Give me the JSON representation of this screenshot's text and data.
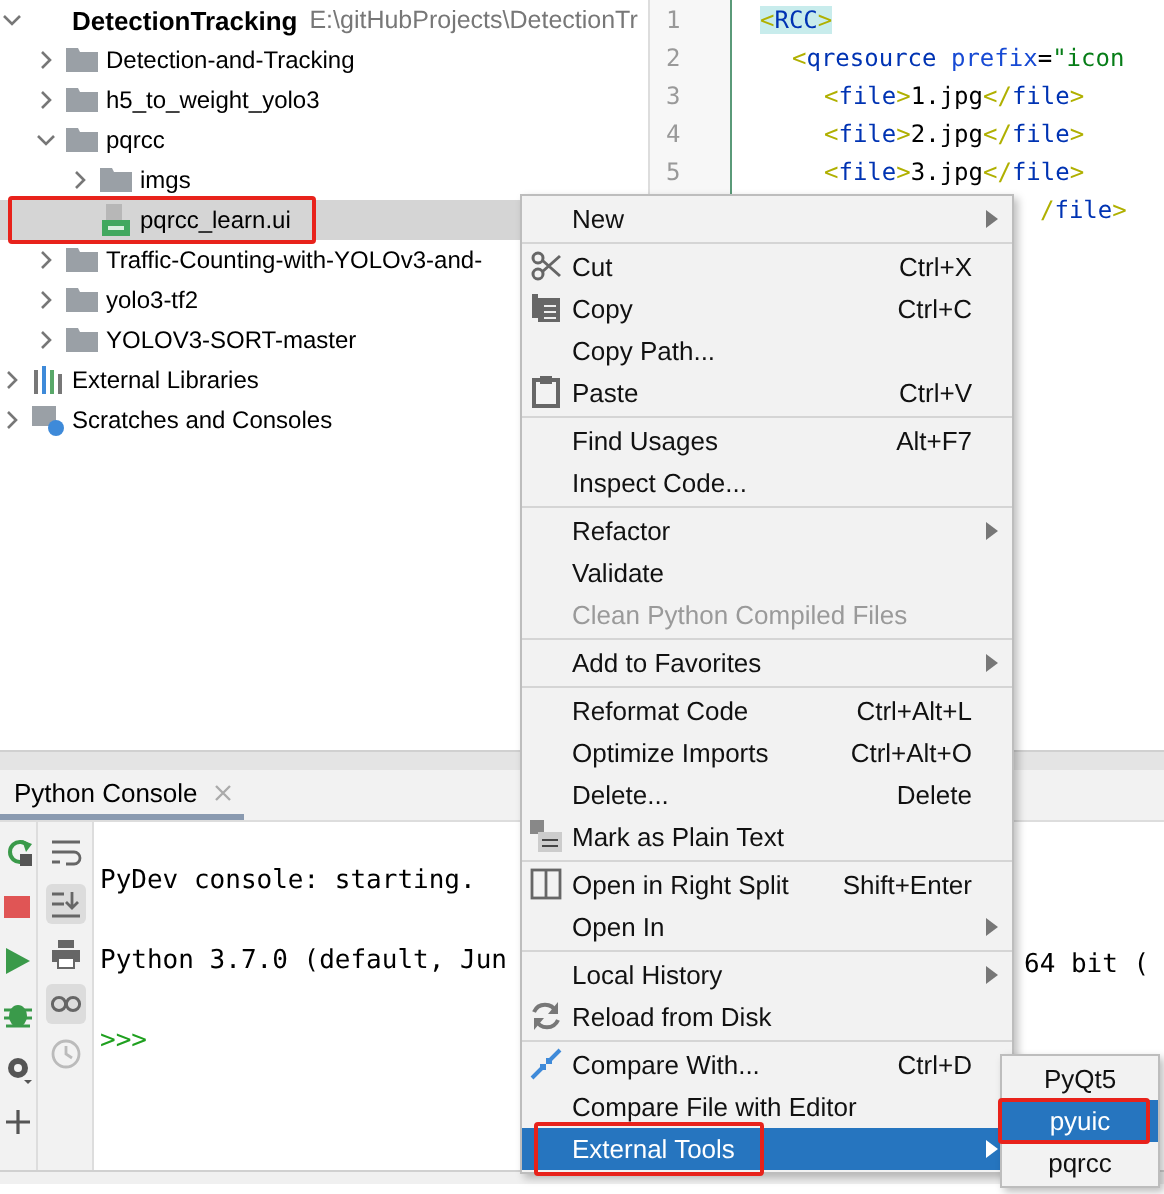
{
  "project_tree": {
    "root": {
      "name": "DetectionTracking",
      "path": "E:\\gitHubProjects\\DetectionTr",
      "expanded": true,
      "children": [
        {
          "name": "Detection-and-Tracking",
          "kind": "folder",
          "expanded": false,
          "selected": false,
          "highlighted": false
        },
        {
          "name": "h5_to_weight_yolo3",
          "kind": "folder",
          "expanded": false,
          "selected": false,
          "highlighted": false
        },
        {
          "name": "pqrcc",
          "kind": "folder",
          "expanded": true,
          "selected": false,
          "highlighted": false,
          "children": [
            {
              "name": "imgs",
              "kind": "folder",
              "expanded": false,
              "selected": false,
              "highlighted": false
            },
            {
              "name": "pqrcc_learn.ui",
              "kind": "file",
              "selected": true,
              "highlighted": true
            }
          ]
        },
        {
          "name": "Traffic-Counting-with-YOLOv3-and-",
          "kind": "folder",
          "expanded": false,
          "selected": false,
          "highlighted": false
        },
        {
          "name": "yolo3-tf2",
          "kind": "folder",
          "expanded": false,
          "selected": false,
          "highlighted": false
        },
        {
          "name": "YOLOV3-SORT-master",
          "kind": "folder",
          "expanded": false,
          "selected": false,
          "highlighted": false
        }
      ]
    },
    "extra": [
      {
        "name": "External Libraries",
        "kind": "libraries",
        "expanded": false,
        "selected": false,
        "highlighted": false
      },
      {
        "name": "Scratches and Consoles",
        "kind": "scratches",
        "expanded": false,
        "selected": false,
        "highlighted": false
      }
    ]
  },
  "editor": {
    "lines": [
      {
        "number": "1",
        "current": true,
        "tokens": [
          {
            "text": "<",
            "kind": "bracket"
          },
          {
            "text": "RCC",
            "kind": "tag"
          },
          {
            "text": ">",
            "kind": "bracket"
          }
        ],
        "children": [
          {
            "number": "2",
            "current": false,
            "tokens": [
              {
                "text": "<",
                "kind": "bracket"
              },
              {
                "text": "qresource ",
                "kind": "tag"
              },
              {
                "text": "prefix",
                "kind": "attr"
              },
              {
                "text": "=",
                "kind": "text"
              },
              {
                "text": "\"icon",
                "kind": "string"
              }
            ],
            "children": [
              {
                "number": "3",
                "current": false,
                "tokens": [
                  {
                    "text": "<",
                    "kind": "bracket"
                  },
                  {
                    "text": "file",
                    "kind": "tag"
                  },
                  {
                    "text": ">",
                    "kind": "bracket"
                  },
                  {
                    "text": "1.jpg",
                    "kind": "text"
                  },
                  {
                    "text": "</",
                    "kind": "bracket"
                  },
                  {
                    "text": "file",
                    "kind": "tag"
                  },
                  {
                    "text": ">",
                    "kind": "bracket"
                  }
                ]
              },
              {
                "number": "4",
                "current": false,
                "tokens": [
                  {
                    "text": "<",
                    "kind": "bracket"
                  },
                  {
                    "text": "file",
                    "kind": "tag"
                  },
                  {
                    "text": ">",
                    "kind": "bracket"
                  },
                  {
                    "text": "2.jpg",
                    "kind": "text"
                  },
                  {
                    "text": "</",
                    "kind": "bracket"
                  },
                  {
                    "text": "file",
                    "kind": "tag"
                  },
                  {
                    "text": ">",
                    "kind": "bracket"
                  }
                ]
              },
              {
                "number": "5",
                "current": false,
                "tokens": [
                  {
                    "text": "<",
                    "kind": "bracket"
                  },
                  {
                    "text": "file",
                    "kind": "tag"
                  },
                  {
                    "text": ">",
                    "kind": "bracket"
                  },
                  {
                    "text": "3.jpg",
                    "kind": "text"
                  },
                  {
                    "text": "</",
                    "kind": "bracket"
                  },
                  {
                    "text": "file",
                    "kind": "tag"
                  },
                  {
                    "text": ">",
                    "kind": "bracket"
                  }
                ]
              },
              {
                "current": false,
                "tail": true,
                "tokens": [
                  {
                    "text": "/",
                    "kind": "bracket"
                  },
                  {
                    "text": "file",
                    "kind": "tag"
                  },
                  {
                    "text": ">",
                    "kind": "bracket"
                  }
                ]
              }
            ]
          }
        ]
      }
    ]
  },
  "console": {
    "tab": {
      "label": "Python Console",
      "selected": true
    },
    "lines": [
      {
        "text": "PyDev console: starting.",
        "kind": "output"
      },
      {
        "text": "Python 3.7.0 (default, Jun",
        "kind": "output"
      },
      {
        "text": ">>>",
        "kind": "prompt"
      }
    ],
    "trailing_text": "64 bit ("
  },
  "context_menu": {
    "items": [
      {
        "kind": "item",
        "label": "New",
        "submenu": true,
        "disabled": false,
        "selected": false,
        "highlighted": false
      },
      {
        "kind": "separator"
      },
      {
        "kind": "item",
        "label": "Cut",
        "shortcut": "Ctrl+X",
        "disabled": false,
        "selected": false,
        "highlighted": false
      },
      {
        "kind": "item",
        "label": "Copy",
        "shortcut": "Ctrl+C",
        "disabled": false,
        "selected": false,
        "highlighted": false
      },
      {
        "kind": "item",
        "label": "Copy Path...",
        "disabled": false,
        "selected": false,
        "highlighted": false
      },
      {
        "kind": "item",
        "label": "Paste",
        "shortcut": "Ctrl+V",
        "disabled": false,
        "selected": false,
        "highlighted": false
      },
      {
        "kind": "separator"
      },
      {
        "kind": "item",
        "label": "Find Usages",
        "shortcut": "Alt+F7",
        "disabled": false,
        "selected": false,
        "highlighted": false
      },
      {
        "kind": "item",
        "label": "Inspect Code...",
        "disabled": false,
        "selected": false,
        "highlighted": false
      },
      {
        "kind": "separator"
      },
      {
        "kind": "item",
        "label": "Refactor",
        "submenu": true,
        "disabled": false,
        "selected": false,
        "highlighted": false
      },
      {
        "kind": "item",
        "label": "Validate",
        "disabled": false,
        "selected": false,
        "highlighted": false
      },
      {
        "kind": "item",
        "label": "Clean Python Compiled Files",
        "disabled": true,
        "selected": false,
        "highlighted": false
      },
      {
        "kind": "separator"
      },
      {
        "kind": "item",
        "label": "Add to Favorites",
        "submenu": true,
        "disabled": false,
        "selected": false,
        "highlighted": false
      },
      {
        "kind": "separator"
      },
      {
        "kind": "item",
        "label": "Reformat Code",
        "shortcut": "Ctrl+Alt+L",
        "disabled": false,
        "selected": false,
        "highlighted": false
      },
      {
        "kind": "item",
        "label": "Optimize Imports",
        "shortcut": "Ctrl+Alt+O",
        "disabled": false,
        "selected": false,
        "highlighted": false
      },
      {
        "kind": "item",
        "label": "Delete...",
        "shortcut": "Delete",
        "disabled": false,
        "selected": false,
        "highlighted": false
      },
      {
        "kind": "item",
        "label": "Mark as Plain Text",
        "disabled": false,
        "selected": false,
        "highlighted": false
      },
      {
        "kind": "separator"
      },
      {
        "kind": "item",
        "label": "Open in Right Split",
        "shortcut": "Shift+Enter",
        "disabled": false,
        "selected": false,
        "highlighted": false
      },
      {
        "kind": "item",
        "label": "Open In",
        "submenu": true,
        "disabled": false,
        "selected": false,
        "highlighted": false
      },
      {
        "kind": "separator"
      },
      {
        "kind": "item",
        "label": "Local History",
        "submenu": true,
        "disabled": false,
        "selected": false,
        "highlighted": false
      },
      {
        "kind": "item",
        "label": "Reload from Disk",
        "disabled": false,
        "selected": false,
        "highlighted": false
      },
      {
        "kind": "separator"
      },
      {
        "kind": "item",
        "label": "Compare With...",
        "shortcut": "Ctrl+D",
        "disabled": false,
        "selected": false,
        "highlighted": false
      },
      {
        "kind": "item",
        "label": "Compare File with Editor",
        "disabled": false,
        "selected": false,
        "highlighted": false
      },
      {
        "kind": "item",
        "label": "External Tools",
        "submenu": true,
        "disabled": false,
        "selected": true,
        "highlighted": true
      }
    ]
  },
  "submenu": {
    "items": [
      {
        "label": "PyQt5",
        "selected": false,
        "highlighted": false
      },
      {
        "label": "pyuic",
        "selected": true,
        "highlighted": true
      },
      {
        "label": "pqrcc",
        "selected": false,
        "highlighted": false
      }
    ]
  }
}
